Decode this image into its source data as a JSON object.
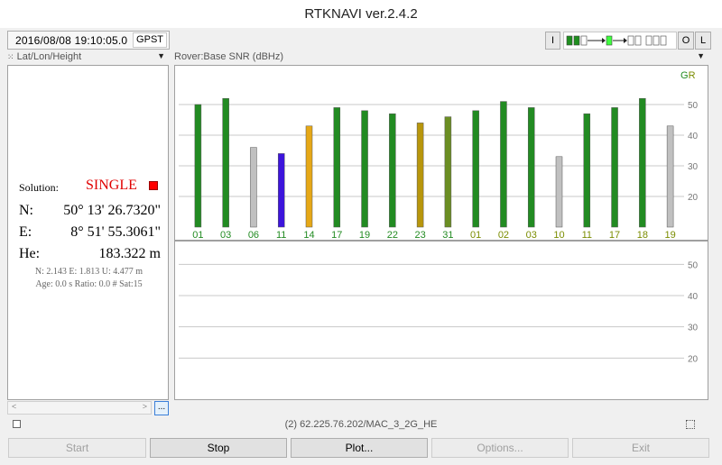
{
  "window": {
    "title": "RTKNAVI ver.2.4.2"
  },
  "toolbar": {
    "time": "2016/08/08 19:10:05.0",
    "time_system": "GPST",
    "btn_i": "I",
    "btn_o": "O",
    "btn_l": "L"
  },
  "left": {
    "combo_label": "Lat/Lon/Height",
    "solution_label": "Solution:",
    "solution_value": "SINGLE",
    "solution_color": "#ff0000",
    "n_label": "N:",
    "n_value": "50° 13' 26.7320\"",
    "e_label": "E:",
    "e_value": "8° 51' 55.3061\"",
    "h_label": "He:",
    "h_value": "183.322 m",
    "std_line": "N: 2.143 E: 1.813 U: 4.477 m",
    "info_line": "Age: 0.0 s Ratio: 0.0 # Sat:15",
    "scroll_left": "<",
    "scroll_right": ">",
    "dots_button": "..."
  },
  "right": {
    "combo_label": "Rover:Base SNR (dBHz)"
  },
  "status": {
    "text": "(2) 62.225.76.202/MAC_3_2G_HE"
  },
  "buttons": {
    "start": "Start",
    "stop": "Stop",
    "plot": "Plot...",
    "options": "Options...",
    "exit": "Exit"
  },
  "chart_data": [
    {
      "type": "bar",
      "legend_text": "GR",
      "legend_colors": [
        "#228b22",
        "#7a8c00"
      ],
      "ylim": [
        10,
        55
      ],
      "yticks": [
        20,
        30,
        40,
        50
      ],
      "grid": true,
      "categories": [
        "01",
        "03",
        "06",
        "11",
        "14",
        "17",
        "19",
        "22",
        "23",
        "31",
        "01",
        "02",
        "03",
        "10",
        "11",
        "17",
        "18",
        "19"
      ],
      "values": [
        50,
        52,
        36,
        34,
        43,
        49,
        48,
        47,
        44,
        46,
        48,
        51,
        49,
        33,
        47,
        49,
        52,
        43
      ],
      "bar_colors": [
        "#228b22",
        "#228b22",
        "#c0c0c0",
        "#3c14dc",
        "#e6a817",
        "#228b22",
        "#228b22",
        "#228b22",
        "#b8960c",
        "#6b8e23",
        "#228b22",
        "#228b22",
        "#228b22",
        "#c0c0c0",
        "#228b22",
        "#228b22",
        "#228b22",
        "#c0c0c0"
      ],
      "label_colors": [
        "#228b22",
        "#228b22",
        "#228b22",
        "#228b22",
        "#228b22",
        "#228b22",
        "#228b22",
        "#228b22",
        "#228b22",
        "#228b22",
        "#7a8c00",
        "#7a8c00",
        "#7a8c00",
        "#7a8c00",
        "#7a8c00",
        "#7a8c00",
        "#7a8c00",
        "#7a8c00"
      ]
    },
    {
      "type": "bar",
      "ylim": [
        10,
        55
      ],
      "yticks": [
        20,
        30,
        40,
        50
      ],
      "grid": true,
      "categories": [],
      "values": []
    }
  ]
}
